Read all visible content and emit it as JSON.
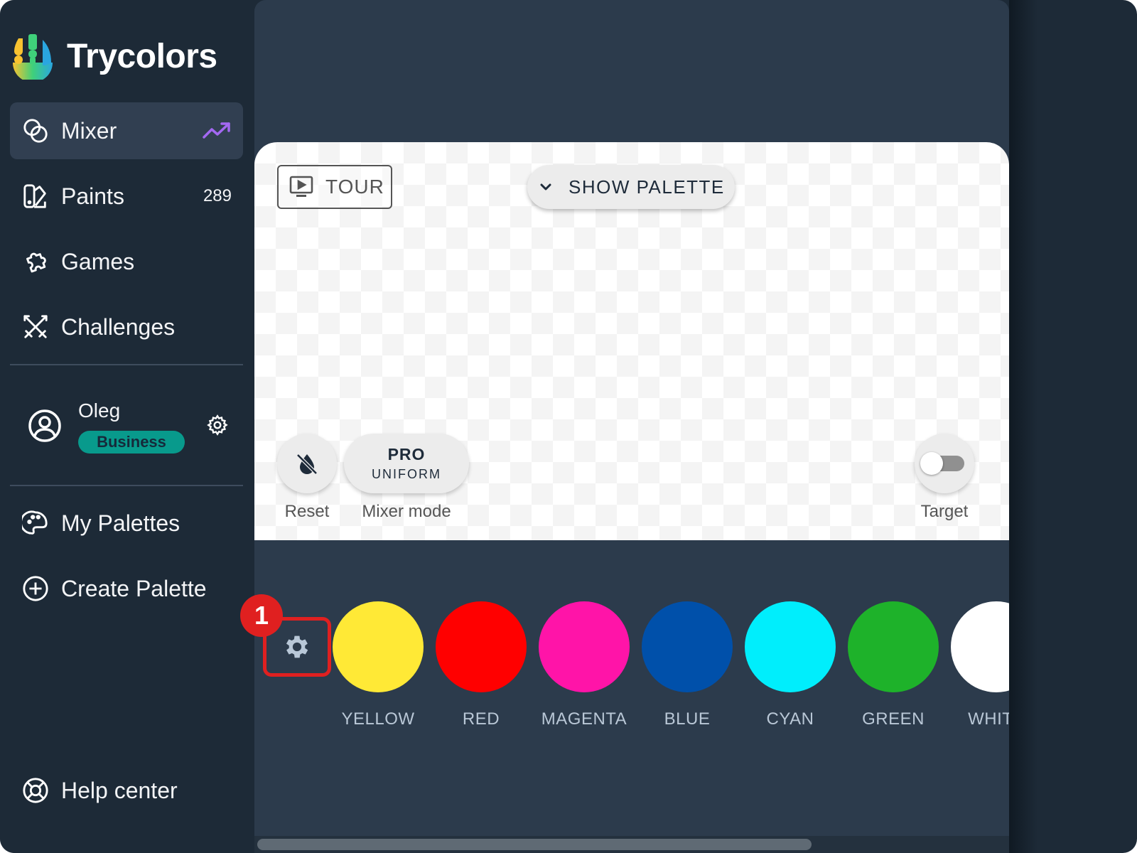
{
  "app": {
    "title": "Trycolors"
  },
  "sidebar": {
    "items": [
      {
        "label": "Mixer",
        "icon": "mixer-circles-icon",
        "active": true,
        "trend_icon": "trending-up-icon"
      },
      {
        "label": "Paints",
        "icon": "paint-swatch-icon",
        "count": "289"
      },
      {
        "label": "Games",
        "icon": "puzzle-icon"
      },
      {
        "label": "Challenges",
        "icon": "crossed-swords-icon"
      }
    ],
    "user": {
      "name": "Oleg",
      "plan": "Business",
      "plan_color": "#089a8c"
    },
    "palette_items": [
      {
        "label": "My Palettes",
        "icon": "palette-icon"
      },
      {
        "label": "Create Palette",
        "icon": "plus-circle-icon"
      }
    ],
    "help": {
      "label": "Help center",
      "icon": "lifebuoy-icon"
    }
  },
  "canvas": {
    "tour_label": "TOUR",
    "show_palette_label": "SHOW PALETTE",
    "reset_label": "Reset",
    "mixer_mode": {
      "top": "PRO",
      "bottom": "UNIFORM",
      "label": "Mixer mode"
    },
    "target": {
      "label": "Target",
      "enabled": false
    }
  },
  "palette": {
    "step_badge": "1",
    "highlight_color": "#e02020",
    "swatches": [
      {
        "name": "YELLOW",
        "color": "#ffe936"
      },
      {
        "name": "RED",
        "color": "#ff0000"
      },
      {
        "name": "MAGENTA",
        "color": "#ff14a8"
      },
      {
        "name": "BLUE",
        "color": "#0050aa"
      },
      {
        "name": "CYAN",
        "color": "#00eefc"
      },
      {
        "name": "GREEN",
        "color": "#1eb22a"
      },
      {
        "name": "WHITE",
        "color": "#ffffff"
      }
    ]
  },
  "scroll": {
    "horizontal_position_fraction": 0.0,
    "visible_fraction": 0.74
  }
}
